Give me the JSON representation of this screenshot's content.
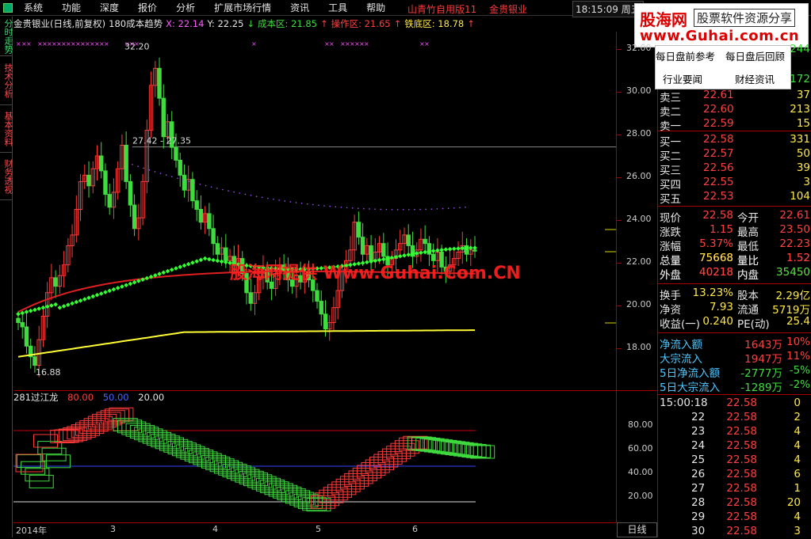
{
  "menu": {
    "items": [
      "系统",
      "功能",
      "深度",
      "报价",
      "分析",
      "扩展市场行情",
      "资讯",
      "工具",
      "帮助"
    ],
    "title_app": "山青竹自用版11",
    "title_stock": "金贵银业",
    "clock": "18:15:09 周五"
  },
  "brand": {
    "name": "股海网",
    "slogan": "股票软件资源分享",
    "url": "www.Guhai.com.cn"
  },
  "left_tabs": [
    "分时走势",
    "技术分析",
    "基本资料",
    "财务透视"
  ],
  "indicator_bar": {
    "stock": "金贵银业(日线,前复权)",
    "indicator": "180成本趋势",
    "x": "X: 22.14",
    "y": "Y: 22.25",
    "cost": "成本区: 21.85",
    "op": "操作区: 21.65",
    "floor": "铁底区: 18.78"
  },
  "chart_annotations": {
    "high": "32.20",
    "range": "27.42 - 27.35",
    "low": "16.88",
    "watermark": "股海网提供 Www.Guhai.Com.CN"
  },
  "y_axis": [
    "32.00",
    "30.00",
    "28.00",
    "26.00",
    "24.00",
    "22.00",
    "20.00",
    "18.00"
  ],
  "sub_indicator": {
    "name": "281过江龙",
    "l1": "80.00",
    "l2": "50.00",
    "l3": "20.00"
  },
  "sub_y_axis": [
    "80.00",
    "60.00",
    "40.00",
    "20.00"
  ],
  "time_axis": [
    "2014年",
    "3",
    "4",
    "5",
    "6"
  ],
  "period_tab": "日线",
  "popup": {
    "a": "每日盘前参考",
    "b": "每日盘后回顾",
    "c": "行业要闻",
    "d": "财经资讯"
  },
  "quote": {
    "top_vals": [
      "244",
      "172"
    ],
    "sells": [
      {
        "label": "卖三",
        "price": "22.61",
        "vol": "37"
      },
      {
        "label": "卖二",
        "price": "22.60",
        "vol": "213"
      },
      {
        "label": "卖一",
        "price": "22.59",
        "vol": "15"
      }
    ],
    "buys": [
      {
        "label": "买一",
        "price": "22.58",
        "vol": "331"
      },
      {
        "label": "买二",
        "price": "22.57",
        "vol": "50"
      },
      {
        "label": "买三",
        "price": "22.56",
        "vol": "39"
      },
      {
        "label": "买四",
        "price": "22.55",
        "vol": "3"
      },
      {
        "label": "买五",
        "price": "22.53",
        "vol": "104"
      }
    ],
    "stats": [
      {
        "l1": "现价",
        "v1": "22.58",
        "l2": "今开",
        "v2": "22.61"
      },
      {
        "l1": "涨跌",
        "v1": "1.15",
        "l2": "最高",
        "v2": "23.50"
      },
      {
        "l1": "涨幅",
        "v1": "5.37%",
        "l2": "最低",
        "v2": "22.23"
      },
      {
        "l1": "总量",
        "v1": "75668",
        "l2": "量比",
        "v2": "1.52"
      },
      {
        "l1": "外盘",
        "v1": "40218",
        "l2": "内盘",
        "v2": "35450"
      }
    ],
    "stats2": [
      {
        "l1": "换手",
        "v1": "13.23%",
        "l2": "股本",
        "v2": "2.29亿"
      },
      {
        "l1": "净资",
        "v1": "7.93",
        "l2": "流通",
        "v2": "5719万"
      },
      {
        "l1": "收益(一)",
        "v1": "0.240",
        "l2": "PE(动)",
        "v2": "25.4"
      }
    ],
    "flows": [
      {
        "l": "净流入额",
        "v": "1643万",
        "p": "10%"
      },
      {
        "l": "大宗流入",
        "v": "1947万",
        "p": "11%"
      },
      {
        "l": "5日净流入额",
        "v": "-2777万",
        "p": "-5%"
      },
      {
        "l": "5日大宗流入",
        "v": "-1289万",
        "p": "-2%"
      }
    ],
    "ticks": [
      {
        "t": "15:00:18",
        "p": "22.58",
        "v": "0"
      },
      {
        "t": "22",
        "p": "22.58",
        "v": "2"
      },
      {
        "t": "23",
        "p": "22.58",
        "v": "4"
      },
      {
        "t": "24",
        "p": "22.58",
        "v": "4"
      },
      {
        "t": "25",
        "p": "22.58",
        "v": "4"
      },
      {
        "t": "26",
        "p": "22.58",
        "v": "6"
      },
      {
        "t": "27",
        "p": "22.58",
        "v": "1"
      },
      {
        "t": "28",
        "p": "22.58",
        "v": "20"
      },
      {
        "t": "29",
        "p": "22.58",
        "v": "4"
      },
      {
        "t": "30",
        "p": "22.58",
        "v": "3"
      }
    ]
  },
  "colors": {
    "up": "#ff3b3b",
    "down": "#3fdc3f",
    "ma_yellow": "#ffff33",
    "ma_red": "#e02020",
    "ma_green": "#33ff33"
  }
}
